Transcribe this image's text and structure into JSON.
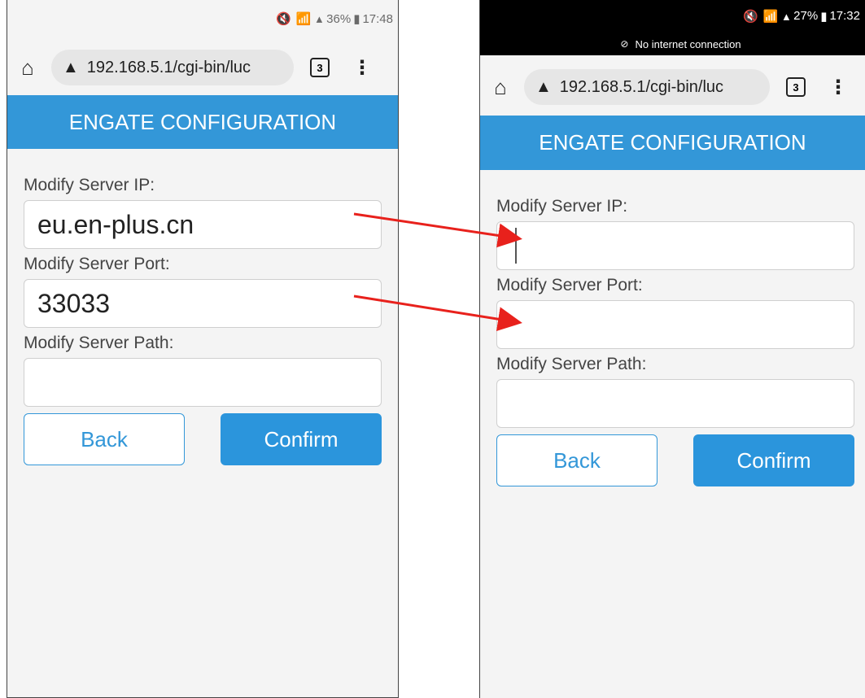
{
  "left": {
    "status": {
      "icons": "🔇 📶 ▴",
      "battery": "36%",
      "time": "17:48"
    },
    "url": {
      "text": "192.168.5.1/cgi-bin/luc",
      "tab_count": "3"
    },
    "header_title": "ENGATE CONFIGURATION",
    "fields": [
      {
        "label": "Modify Server IP:",
        "value": "eu.en-plus.cn"
      },
      {
        "label": "Modify Server Port:",
        "value": "33033"
      },
      {
        "label": "Modify Server Path:",
        "value": ""
      }
    ],
    "buttons": {
      "back": "Back",
      "confirm": "Confirm"
    }
  },
  "right": {
    "status": {
      "icons": "🔇 📶 ▴",
      "battery": "27%",
      "time": "17:32"
    },
    "banner": "No internet connection",
    "url": {
      "text": "192.168.5.1/cgi-bin/luc",
      "tab_count": "3"
    },
    "header_title": "ENGATE CONFIGURATION",
    "fields": [
      {
        "label": "Modify Server IP:",
        "value": ""
      },
      {
        "label": "Modify Server Port:",
        "value": ""
      },
      {
        "label": "Modify Server Path:",
        "value": ""
      }
    ],
    "buttons": {
      "back": "Back",
      "confirm": "Confirm"
    }
  },
  "colors": {
    "accent": "#3397d8",
    "arrow": "#e8211c"
  },
  "icons": [
    "home-icon",
    "warning-icon",
    "tabs-icon",
    "menu-icon",
    "cloud-off-icon"
  ]
}
